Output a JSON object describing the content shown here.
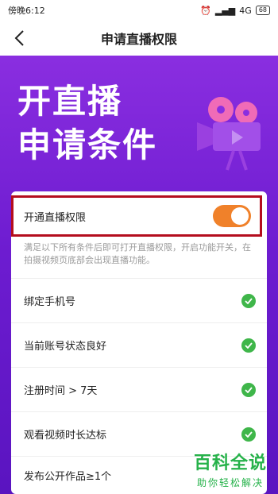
{
  "status_bar": {
    "time": "傍晚6:12",
    "network": "4G",
    "battery": "68"
  },
  "nav": {
    "title": "申请直播权限"
  },
  "hero": {
    "line1": "开直播",
    "line2": "申请条件"
  },
  "toggle": {
    "label": "开通直播权限",
    "state": "on"
  },
  "description": "满足以下所有条件后即可打开直播权限，开启功能开关，在拍摄视频页底部会出现直播功能。",
  "conditions": [
    {
      "label": "绑定手机号",
      "status": "done"
    },
    {
      "label": "当前账号状态良好",
      "status": "done"
    },
    {
      "label": "注册时间 > 7天",
      "status": "done"
    },
    {
      "label": "观看视频时长达标",
      "status": "done"
    },
    {
      "label": "发布公开作品≥1个",
      "status": "done"
    }
  ],
  "watermark": {
    "big": "百科全说",
    "small": "助你轻松解决"
  },
  "colors": {
    "accent": "#f0812a",
    "check": "#3fb64a",
    "hero": "#7a22d8",
    "highlight": "#b40d1e"
  }
}
